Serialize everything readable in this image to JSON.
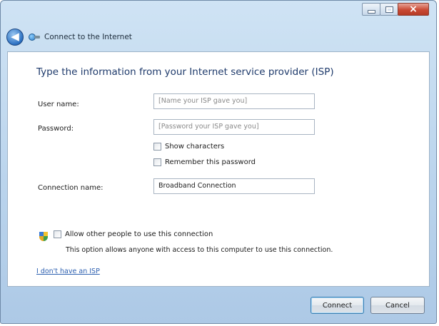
{
  "window": {
    "title": "Connect to the Internet",
    "controls": {
      "minimize_icon": "minimize-icon",
      "maximize_icon": "maximize-icon",
      "close_icon": "close-icon",
      "close_glyph": "×"
    }
  },
  "nav": {
    "back_icon": "back-arrow-icon",
    "back_glyph": "◀",
    "network_icon": "network-connection-icon"
  },
  "form": {
    "heading": "Type the information from your Internet service provider (ISP)",
    "username": {
      "label": "User name:",
      "placeholder": "[Name your ISP gave you]",
      "value": ""
    },
    "password": {
      "label": "Password:",
      "placeholder": "[Password your ISP gave you]",
      "value": ""
    },
    "show_characters": {
      "label": "Show characters",
      "checked": false
    },
    "remember_password": {
      "label": "Remember this password",
      "checked": false
    },
    "connection_name": {
      "label": "Connection name:",
      "value": "Broadband Connection"
    },
    "allow_others": {
      "icon": "security-shield-icon",
      "label": "Allow other people to use this connection",
      "checked": false,
      "description": "This option allows anyone with access to this computer to use this connection."
    },
    "no_isp_link": "I don't have an ISP"
  },
  "footer": {
    "connect_label": "Connect",
    "cancel_label": "Cancel"
  }
}
